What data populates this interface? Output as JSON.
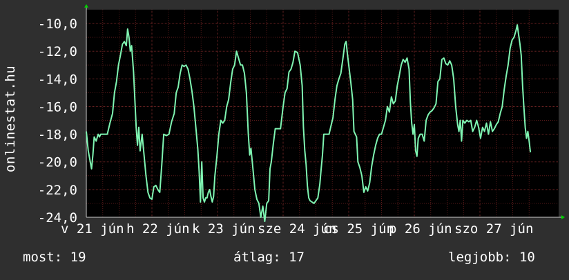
{
  "colors": {
    "background": "#2f2f2f",
    "plot_bg": "#000000",
    "line": "#7ff5b2",
    "grid": "#5a1a1a",
    "arrow": "#00d200"
  },
  "chart_data": {
    "type": "line",
    "watermark": "onlinestat.hu",
    "ylim": [
      -24,
      -9
    ],
    "yticks": [
      "-10,0",
      "-12,0",
      "-14,0",
      "-16,0",
      "-18,0",
      "-20,0",
      "-22,0",
      "-24,0"
    ],
    "ytick_values": [
      -10,
      -12,
      -14,
      -16,
      -18,
      -20,
      -22,
      -24
    ],
    "xlim": [
      0,
      7.2
    ],
    "xticks": [
      {
        "x": 0.0,
        "label": "v 21 jún"
      },
      {
        "x": 1.0,
        "label": "h 22 jún"
      },
      {
        "x": 2.0,
        "label": "k 23 jún"
      },
      {
        "x": 3.0,
        "label": "sze 24 jún"
      },
      {
        "x": 4.0,
        "label": "cs 25 jún"
      },
      {
        "x": 5.0,
        "label": "p 26 jún"
      },
      {
        "x": 6.0,
        "label": "szo 27 jún"
      }
    ],
    "grid": true,
    "series": [
      {
        "points": [
          [
            0.0,
            -17.8
          ],
          [
            0.03,
            -19.2
          ],
          [
            0.06,
            -20.0
          ],
          [
            0.08,
            -20.5
          ],
          [
            0.1,
            -19.5
          ],
          [
            0.12,
            -18.2
          ],
          [
            0.15,
            -18.5
          ],
          [
            0.18,
            -18.0
          ],
          [
            0.2,
            -18.2
          ],
          [
            0.22,
            -18.0
          ],
          [
            0.28,
            -18.0
          ],
          [
            0.32,
            -18.0
          ],
          [
            0.36,
            -17.2
          ],
          [
            0.4,
            -16.5
          ],
          [
            0.43,
            -15.0
          ],
          [
            0.46,
            -14.2
          ],
          [
            0.49,
            -13.0
          ],
          [
            0.52,
            -12.3
          ],
          [
            0.55,
            -11.5
          ],
          [
            0.58,
            -11.3
          ],
          [
            0.61,
            -11.6
          ],
          [
            0.63,
            -10.4
          ],
          [
            0.65,
            -11.0
          ],
          [
            0.67,
            -12.0
          ],
          [
            0.69,
            -11.6
          ],
          [
            0.72,
            -13.5
          ],
          [
            0.74,
            -15.5
          ],
          [
            0.76,
            -17.5
          ],
          [
            0.78,
            -18.8
          ],
          [
            0.8,
            -17.5
          ],
          [
            0.82,
            -19.2
          ],
          [
            0.85,
            -18.0
          ],
          [
            0.88,
            -19.5
          ],
          [
            0.91,
            -21.0
          ],
          [
            0.94,
            -22.2
          ],
          [
            0.97,
            -22.6
          ],
          [
            1.0,
            -22.7
          ],
          [
            1.03,
            -21.8
          ],
          [
            1.06,
            -21.7
          ],
          [
            1.09,
            -22.0
          ],
          [
            1.12,
            -22.2
          ],
          [
            1.15,
            -20.2
          ],
          [
            1.18,
            -18.0
          ],
          [
            1.22,
            -18.1
          ],
          [
            1.26,
            -18.0
          ],
          [
            1.3,
            -17.1
          ],
          [
            1.34,
            -16.5
          ],
          [
            1.37,
            -15.0
          ],
          [
            1.4,
            -14.6
          ],
          [
            1.43,
            -13.6
          ],
          [
            1.46,
            -13.0
          ],
          [
            1.49,
            -13.1
          ],
          [
            1.52,
            -13.0
          ],
          [
            1.55,
            -13.3
          ],
          [
            1.58,
            -14.0
          ],
          [
            1.61,
            -14.9
          ],
          [
            1.64,
            -16.0
          ],
          [
            1.67,
            -17.5
          ],
          [
            1.7,
            -19.1
          ],
          [
            1.72,
            -20.7
          ],
          [
            1.74,
            -22.9
          ],
          [
            1.76,
            -20.0
          ],
          [
            1.78,
            -22.6
          ],
          [
            1.8,
            -22.9
          ],
          [
            1.82,
            -22.6
          ],
          [
            1.84,
            -22.6
          ],
          [
            1.86,
            -22.2
          ],
          [
            1.88,
            -22.0
          ],
          [
            1.9,
            -22.5
          ],
          [
            1.92,
            -22.9
          ],
          [
            1.94,
            -22.5
          ],
          [
            1.96,
            -21.0
          ],
          [
            1.99,
            -19.6
          ],
          [
            2.02,
            -18.0
          ],
          [
            2.05,
            -17.0
          ],
          [
            2.08,
            -17.2
          ],
          [
            2.11,
            -17.0
          ],
          [
            2.14,
            -16.0
          ],
          [
            2.17,
            -15.5
          ],
          [
            2.2,
            -14.3
          ],
          [
            2.23,
            -13.3
          ],
          [
            2.26,
            -13.0
          ],
          [
            2.29,
            -12.0
          ],
          [
            2.32,
            -12.5
          ],
          [
            2.35,
            -13.0
          ],
          [
            2.38,
            -13.0
          ],
          [
            2.41,
            -13.6
          ],
          [
            2.44,
            -15.0
          ],
          [
            2.47,
            -18.0
          ],
          [
            2.49,
            -19.5
          ],
          [
            2.51,
            -19.0
          ],
          [
            2.54,
            -20.5
          ],
          [
            2.57,
            -22.0
          ],
          [
            2.6,
            -22.7
          ],
          [
            2.63,
            -23.0
          ],
          [
            2.66,
            -24.0
          ],
          [
            2.69,
            -23.2
          ],
          [
            2.72,
            -24.3
          ],
          [
            2.75,
            -23.0
          ],
          [
            2.78,
            -22.8
          ],
          [
            2.8,
            -20.5
          ],
          [
            2.82,
            -20.0
          ],
          [
            2.85,
            -18.7
          ],
          [
            2.88,
            -17.6
          ],
          [
            2.92,
            -17.6
          ],
          [
            2.96,
            -17.6
          ],
          [
            3.0,
            -16.0
          ],
          [
            3.03,
            -15.0
          ],
          [
            3.06,
            -14.7
          ],
          [
            3.09,
            -13.5
          ],
          [
            3.12,
            -13.3
          ],
          [
            3.15,
            -12.8
          ],
          [
            3.18,
            -12.0
          ],
          [
            3.22,
            -12.1
          ],
          [
            3.26,
            -13.0
          ],
          [
            3.29,
            -14.5
          ],
          [
            3.31,
            -17.5
          ],
          [
            3.33,
            -19.2
          ],
          [
            3.35,
            -20.2
          ],
          [
            3.37,
            -21.7
          ],
          [
            3.39,
            -22.6
          ],
          [
            3.41,
            -22.8
          ],
          [
            3.44,
            -22.9
          ],
          [
            3.47,
            -23.0
          ],
          [
            3.5,
            -22.8
          ],
          [
            3.53,
            -22.6
          ],
          [
            3.56,
            -21.6
          ],
          [
            3.58,
            -20.5
          ],
          [
            3.6,
            -19.5
          ],
          [
            3.62,
            -18.0
          ],
          [
            3.66,
            -18.0
          ],
          [
            3.7,
            -18.0
          ],
          [
            3.73,
            -17.4
          ],
          [
            3.76,
            -16.8
          ],
          [
            3.79,
            -15.5
          ],
          [
            3.82,
            -14.5
          ],
          [
            3.85,
            -14.0
          ],
          [
            3.88,
            -13.6
          ],
          [
            3.91,
            -12.6
          ],
          [
            3.94,
            -11.5
          ],
          [
            3.96,
            -11.3
          ],
          [
            3.98,
            -12.2
          ],
          [
            4.0,
            -13.0
          ],
          [
            4.03,
            -14.2
          ],
          [
            4.06,
            -15.5
          ],
          [
            4.08,
            -17.8
          ],
          [
            4.1,
            -18.0
          ],
          [
            4.12,
            -18.2
          ],
          [
            4.14,
            -20.0
          ],
          [
            4.17,
            -20.4
          ],
          [
            4.2,
            -21.0
          ],
          [
            4.23,
            -22.2
          ],
          [
            4.26,
            -21.8
          ],
          [
            4.29,
            -22.1
          ],
          [
            4.32,
            -21.5
          ],
          [
            4.35,
            -20.3
          ],
          [
            4.38,
            -19.5
          ],
          [
            4.41,
            -18.8
          ],
          [
            4.44,
            -18.3
          ],
          [
            4.47,
            -18.0
          ],
          [
            4.5,
            -18.0
          ],
          [
            4.53,
            -17.5
          ],
          [
            4.56,
            -17.0
          ],
          [
            4.59,
            -16.0
          ],
          [
            4.62,
            -16.4
          ],
          [
            4.65,
            -15.3
          ],
          [
            4.68,
            -15.8
          ],
          [
            4.71,
            -15.6
          ],
          [
            4.74,
            -14.5
          ],
          [
            4.77,
            -13.8
          ],
          [
            4.8,
            -13.0
          ],
          [
            4.83,
            -12.6
          ],
          [
            4.86,
            -12.8
          ],
          [
            4.89,
            -12.5
          ],
          [
            4.92,
            -13.3
          ],
          [
            4.94,
            -15.7
          ],
          [
            4.96,
            -17.2
          ],
          [
            4.98,
            -18.0
          ],
          [
            5.0,
            -17.3
          ],
          [
            5.02,
            -19.2
          ],
          [
            5.04,
            -19.6
          ],
          [
            5.06,
            -18.3
          ],
          [
            5.09,
            -18.0
          ],
          [
            5.12,
            -18.0
          ],
          [
            5.15,
            -18.5
          ],
          [
            5.18,
            -17.0
          ],
          [
            5.21,
            -16.6
          ],
          [
            5.24,
            -16.4
          ],
          [
            5.27,
            -16.3
          ],
          [
            5.3,
            -16.1
          ],
          [
            5.33,
            -15.8
          ],
          [
            5.36,
            -14.2
          ],
          [
            5.39,
            -14.0
          ],
          [
            5.42,
            -12.6
          ],
          [
            5.45,
            -12.5
          ],
          [
            5.48,
            -12.9
          ],
          [
            5.51,
            -13.0
          ],
          [
            5.54,
            -12.7
          ],
          [
            5.57,
            -13.0
          ],
          [
            5.6,
            -14.0
          ],
          [
            5.63,
            -16.0
          ],
          [
            5.66,
            -17.3
          ],
          [
            5.68,
            -17.8
          ],
          [
            5.7,
            -17.0
          ],
          [
            5.72,
            -18.5
          ],
          [
            5.74,
            -17.0
          ],
          [
            5.77,
            -17.2
          ],
          [
            5.8,
            -17.0
          ],
          [
            5.83,
            -17.1
          ],
          [
            5.86,
            -17.0
          ],
          [
            5.89,
            -17.8
          ],
          [
            5.92,
            -17.5
          ],
          [
            5.95,
            -17.0
          ],
          [
            5.98,
            -17.5
          ],
          [
            6.01,
            -18.3
          ],
          [
            6.04,
            -17.5
          ],
          [
            6.07,
            -17.8
          ],
          [
            6.1,
            -17.2
          ],
          [
            6.13,
            -18.0
          ],
          [
            6.16,
            -17.1
          ],
          [
            6.19,
            -17.8
          ],
          [
            6.22,
            -17.6
          ],
          [
            6.25,
            -17.3
          ],
          [
            6.28,
            -17.1
          ],
          [
            6.31,
            -16.5
          ],
          [
            6.34,
            -16.0
          ],
          [
            6.37,
            -14.8
          ],
          [
            6.4,
            -13.8
          ],
          [
            6.43,
            -13.0
          ],
          [
            6.46,
            -11.8
          ],
          [
            6.49,
            -11.2
          ],
          [
            6.52,
            -11.0
          ],
          [
            6.55,
            -10.5
          ],
          [
            6.57,
            -10.1
          ],
          [
            6.59,
            -10.8
          ],
          [
            6.61,
            -11.5
          ],
          [
            6.63,
            -12.3
          ],
          [
            6.65,
            -14.5
          ],
          [
            6.67,
            -16.0
          ],
          [
            6.69,
            -17.5
          ],
          [
            6.71,
            -18.3
          ],
          [
            6.73,
            -17.8
          ],
          [
            6.75,
            -18.5
          ],
          [
            6.77,
            -19.3
          ]
        ]
      }
    ]
  },
  "footer": {
    "now_label": "most:",
    "now_value": "19",
    "avg_label": "átlag:",
    "avg_value": "17",
    "best_label": "legjobb:",
    "best_value": "10"
  }
}
